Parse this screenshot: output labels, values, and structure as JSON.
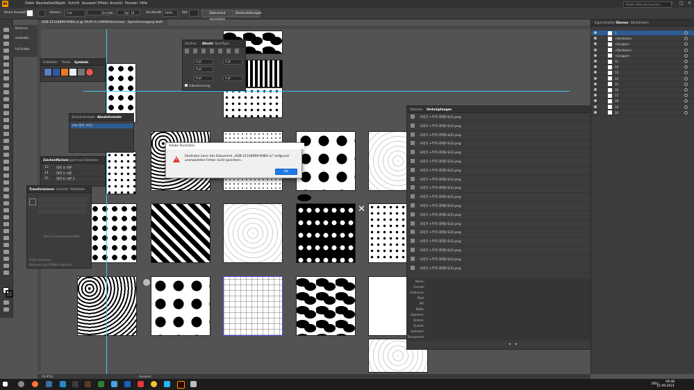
{
  "menubar": {
    "items": [
      "Datei",
      "Bearbeiten",
      "Objekt",
      "Schrift",
      "Auswahl",
      "Effekt",
      "Ansicht",
      "Fenster",
      "Hilfe"
    ],
    "search_placeholder": "Adobe Hilfe durchsuchen"
  },
  "control_bar": {
    "selection_label": "Keine Auswahl",
    "kontur_label": "Kontur:",
    "kontur_value": "1 pt",
    "stroke_style": "Gleichm.",
    "brush_value": "Spt. 10",
    "deckkraft_label": "Deckkraft:",
    "deckkraft_value": "100%",
    "stil_label": "Stil:",
    "doc_setup_button": "Dokument einrichten",
    "prefs_button": "Voreinstellungen"
  },
  "document_tab": {
    "title": "ADB-21104899-R6BH.ai @ 29,95 % (CMYK/Vorschau) - Speichervorgang läuft 54 %"
  },
  "left_mini_panel": {
    "items": [
      "Konturen",
      "Autokalib…",
      "Init.Erstbe"
    ]
  },
  "symbols_panel": {
    "tabs": [
      "Farbfelder",
      "Pinsel",
      "Symbole"
    ],
    "active": "Symbole"
  },
  "para_panel": {
    "tabs": [
      "Zeichen",
      "Absatz",
      "OpenType"
    ],
    "active": "Absatz",
    "fields": [
      "0 pt",
      "0 pt",
      "0 pt",
      "0 pt",
      "0 pt"
    ],
    "checkbox_label": "Silbentrennung"
  },
  "char_styles_panel": {
    "tabs": [
      "Zeichenformate",
      "Absatzformate"
    ],
    "active": "Absatzformate",
    "item": "[Ab 정의 서식]"
  },
  "artboards_panel": {
    "tabs": [
      "Zeichenflächen",
      "Export von Elemente"
    ],
    "rows": [
      {
        "num": "13",
        "name": "대지 4 사본"
      },
      {
        "num": "14",
        "name": "대지 5 사본"
      },
      {
        "num": "15",
        "name": "대지 6 사본 2"
      }
    ]
  },
  "transform_panel": {
    "tabs": [
      "Transformieren",
      "Ausricht",
      "Pathfinder"
    ],
    "active": "Transformieren",
    "empty_text": "Keine Formeigenschaften",
    "opt1": "Ecken skalieren",
    "opt2": "Konturen und Effekte skalieren"
  },
  "links_panel": {
    "tabs": [
      "Aktionen",
      "Verknüpfungen"
    ],
    "active": "Verknüpfungen",
    "link_name": "사각기 +무지-과제3-S(2).png",
    "link_count": 18,
    "info_labels": [
      "Name:",
      "Format:",
      "Farbraum:",
      "Pfad:",
      "PPI:",
      "Maße:",
      "Skalieren:",
      "Drehen:",
      "Erstellt:",
      "Geändert:",
      "Transparent:"
    ]
  },
  "layers_panel": {
    "tabs": [
      "Eigenschaften",
      "Ebenen",
      "Bibliotheken"
    ],
    "active": "Ebenen",
    "rows": [
      "1",
      "<Rechteck>",
      "<Gruppe>",
      "<Rechteck>",
      "<Gruppe>",
      "11",
      "12",
      "13",
      "14",
      "15",
      "16",
      "17",
      "18",
      "19",
      "20"
    ]
  },
  "dialog": {
    "title": "Adobe Illustrator",
    "message": "Illustrator kann das Dokument „ADB-21104899-R6BH.ai\" aufgrund unerwarteter Fehler nicht speichern.",
    "ok_label": "OK"
  },
  "statusbar": {
    "zoom": "29,95%",
    "mode": "Auswahl"
  },
  "taskbar": {
    "time": "09:48",
    "date": "21.09.2021",
    "lang": "DEU"
  },
  "colors": {
    "accent": "#1e7ae8",
    "warning": "#e0312e",
    "guide": "#3cc7f0",
    "app_icon": "#ff9a00"
  }
}
